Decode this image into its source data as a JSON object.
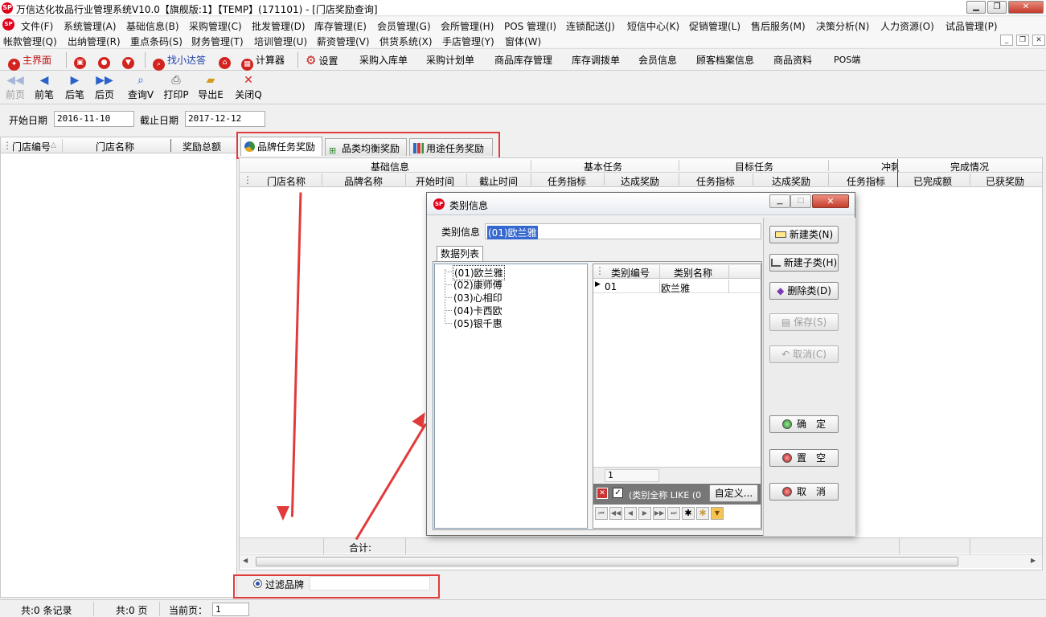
{
  "window": {
    "logo": "SP",
    "title": "万信达化妆品行业管理系统V10.0【旗舰版:1】【TEMP】(171101) - [门店奖励查询]"
  },
  "menu_row1": [
    "文件(F)",
    "系统管理(A)",
    "基础信息(B)",
    "采购管理(C)",
    "批发管理(D)",
    "库存管理(E)",
    "会员管理(G)",
    "会所管理(H)",
    "POS 管理(I)",
    "连锁配送(J)",
    "短信中心(K)",
    "促销管理(L)",
    "售后服务(M)",
    "决策分析(N)",
    "人力资源(O)",
    "试品管理(P)"
  ],
  "menu_row2": [
    "帐款管理(Q)",
    "出纳管理(R)",
    "重点条码(S)",
    "财务管理(T)",
    "培训管理(U)",
    "薪资管理(V)",
    "供货系统(X)",
    "手店管理(Y)",
    "窗体(W)"
  ],
  "quickbar": {
    "home": "主界面",
    "find": "找小达答",
    "calc": "计算器",
    "settings": "设置",
    "links": [
      "采购入库单",
      "采购计划单",
      "商品库存管理",
      "库存调拨单",
      "会员信息",
      "顾客档案信息",
      "商品资料",
      "POS端"
    ]
  },
  "toolbar": {
    "first": "前页",
    "prev": "前笔",
    "next": "后笔",
    "last": "后页",
    "query": "查询V",
    "print": "打印P",
    "export": "导出E",
    "close": "关闭Q"
  },
  "filter": {
    "start_label": "开始日期",
    "start_value": "2016-11-10",
    "end_label": "截止日期",
    "end_value": "2017-12-12"
  },
  "left_table": {
    "columns": [
      "门店编号",
      "门店名称",
      "奖励总额"
    ]
  },
  "tabs": [
    "品牌任务奖励",
    "品类均衡奖励",
    "用途任务奖励"
  ],
  "grid": {
    "group_headers": [
      "基础信息",
      "基本任务",
      "目标任务",
      "冲刺",
      "完成情况"
    ],
    "columns": [
      "门店名称",
      "品牌名称",
      "开始时间",
      "截止时间",
      "任务指标",
      "达成奖励",
      "任务指标",
      "达成奖励",
      "任务指标",
      "已完成额",
      "已获奖励"
    ],
    "total_label": "合计:"
  },
  "brand_filter": {
    "label": "过滤品牌",
    "value": ""
  },
  "status": {
    "records": "共:0 条记录",
    "pages": "共:0 页",
    "current_label": "当前页：",
    "current_value": "1"
  },
  "dialog": {
    "title": "类别信息",
    "category_label": "类别信息",
    "category_value": "(01)欧兰雅",
    "tab": "数据列表",
    "tree": [
      "(01)欧兰雅",
      "(02)康师傅",
      "(03)心相印",
      "(04)卡西欧",
      "(05)银千惠"
    ],
    "list_columns": [
      "类别编号",
      "类别名称"
    ],
    "list_rows": [
      {
        "code": "01",
        "name": "欧兰雅"
      }
    ],
    "row_count": "1",
    "filter_text": "(类别全称 LIKE (0",
    "customize": "自定义...",
    "buttons": {
      "new": "新建类(N)",
      "new_child": "新建子类(H)",
      "delete": "删除类(D)",
      "save": "保存(S)",
      "cancel_edit": "取消(C)",
      "ok": "确　定",
      "clear": "置　空",
      "cancel": "取　消"
    }
  },
  "accent_red": "#e23b3b"
}
